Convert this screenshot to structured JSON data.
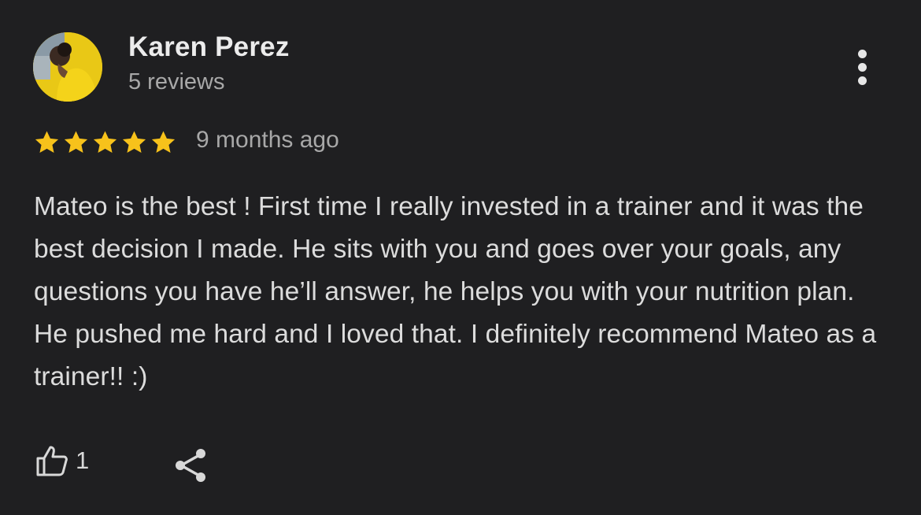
{
  "review": {
    "reviewer_name": "Karen Perez",
    "reviews_count": "5 reviews",
    "rating": 5,
    "rating_max": 5,
    "time_ago": "9 months ago",
    "text": "Mateo is the best ! First time I really invested in a trainer and it was the best decision I made. He sits with you and goes over your goals, any questions you have he’ll answer, he helps you with your nutrition plan. He pushed me hard and I loved that. I definitely recommend Mateo as a trainer!! :)",
    "likes": "1"
  },
  "icons": {
    "more": "more-vert-icon",
    "star": "star-icon",
    "like": "thumbs-up-icon",
    "share": "share-icon"
  },
  "colors": {
    "background": "#1f1f21",
    "star": "#f7c21b",
    "primary_text": "#ececec",
    "secondary_text": "#a8a8a8"
  }
}
